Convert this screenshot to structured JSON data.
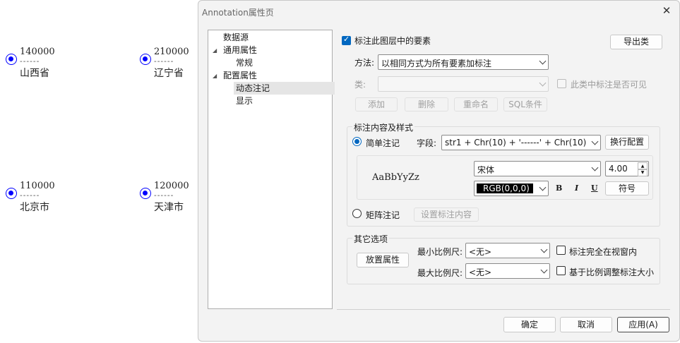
{
  "map": {
    "labels": [
      {
        "value": "140000",
        "dashes": "------",
        "name": "山西省"
      },
      {
        "value": "210000",
        "dashes": "------",
        "name": "辽宁省"
      },
      {
        "value": "110000",
        "dashes": "------",
        "name": "北京市"
      },
      {
        "value": "120000",
        "dashes": "------",
        "name": "天津市"
      }
    ],
    "point_color": "#0000ff"
  },
  "dialog": {
    "title": "Annotation属性页",
    "close_icon": "close-icon",
    "tree": [
      {
        "label": "数据源"
      },
      {
        "label": "通用属性"
      },
      {
        "label": "常规"
      },
      {
        "label": "配置属性"
      },
      {
        "label": "动态注记",
        "selected": true
      },
      {
        "label": "显示"
      }
    ],
    "label_features": {
      "label": "标注此图层中的要素",
      "checked": true
    },
    "export_button": "导出类",
    "method": {
      "label": "方法:",
      "value": "以相同方式为所有要素加标注"
    },
    "class": {
      "label": "类:",
      "value": "",
      "visible_label": "此类中标注是否可见",
      "visible_checked": false
    },
    "class_buttons": {
      "add": "添加",
      "delete": "删除",
      "rename": "重命名",
      "sql": "SQL条件"
    },
    "content_group": {
      "title": "标注内容及样式",
      "simple": {
        "label": "简单注记",
        "selected": true
      },
      "field": {
        "label": "字段:",
        "value": "str1 +  Chr(10) + '------' + Chr(10) + "
      },
      "wrap_button": "换行配置",
      "preview": "AaBbYyZz",
      "font": {
        "value": "宋体"
      },
      "size": {
        "value": "4.00"
      },
      "color": {
        "value": "RGB(0,0,0)"
      },
      "bold": "B",
      "italic": "I",
      "underline": "U",
      "symbol_button": "符号",
      "matrix": {
        "label": "矩阵注记",
        "selected": false
      },
      "set_content_button": "设置标注内容"
    },
    "other_group": {
      "title": "其它选项",
      "placement_button": "放置属性",
      "min_scale": {
        "label": "最小比例尺:",
        "value": "<无>"
      },
      "max_scale": {
        "label": "最大比例尺:",
        "value": "<无>"
      },
      "fully_in_view": {
        "label": "标注完全在视窗内",
        "checked": false
      },
      "scale_size": {
        "label": "基于比例调整标注大小",
        "checked": false
      }
    },
    "footer": {
      "ok": "确定",
      "cancel": "取消",
      "apply": "应用(A)"
    },
    "accent_color": "#0067c0"
  }
}
